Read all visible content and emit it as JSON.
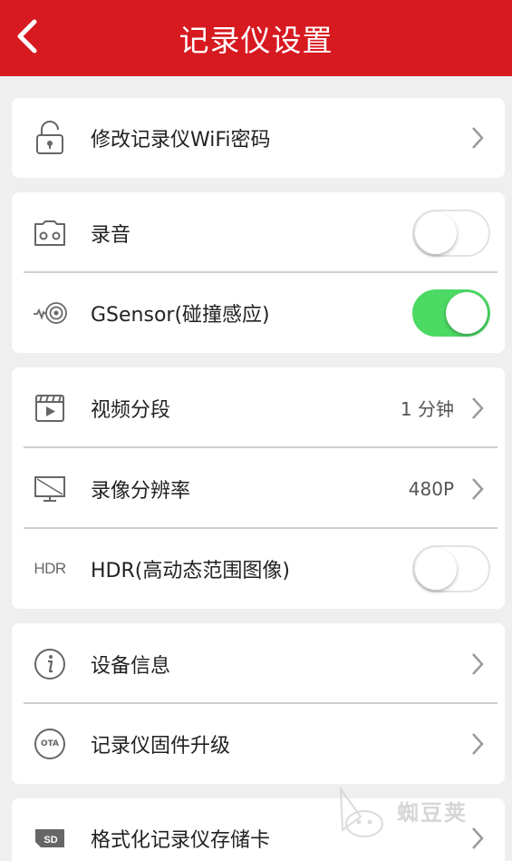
{
  "header": {
    "title": "记录仪设置",
    "back_icon": "chevron-left-icon",
    "background_color": "#d71920"
  },
  "groups": [
    {
      "rows": [
        {
          "label": "修改记录仪WiFi密码",
          "icon": "lock-icon",
          "control": "chevron"
        }
      ]
    },
    {
      "rows": [
        {
          "label": "录音",
          "icon": "cassette-icon",
          "control": "toggle",
          "toggle_on": false
        },
        {
          "label": "GSensor(碰撞感应)",
          "icon": "gsensor-icon",
          "control": "toggle",
          "toggle_on": true
        }
      ]
    },
    {
      "rows": [
        {
          "label": "视频分段",
          "icon": "clapperboard-icon",
          "control": "chevron",
          "value": "1 分钟"
        },
        {
          "label": "录像分辨率",
          "icon": "monitor-icon",
          "control": "chevron",
          "value": "480P"
        },
        {
          "label": "HDR(高动态范围图像)",
          "icon": "hdr-icon",
          "icon_text": "HDR",
          "control": "toggle",
          "toggle_on": false
        }
      ]
    },
    {
      "rows": [
        {
          "label": "设备信息",
          "icon": "info-icon",
          "control": "chevron"
        },
        {
          "label": "记录仪固件升级",
          "icon": "ota-icon",
          "icon_text": "OTA",
          "control": "chevron"
        }
      ]
    },
    {
      "rows": [
        {
          "label": "格式化记录仪存储卡",
          "icon": "sd-card-icon",
          "icon_text": "SD",
          "control": "chevron"
        }
      ]
    }
  ],
  "watermark": {
    "text": "蜘豆荚"
  },
  "colors": {
    "toggle_on": "#4cd964",
    "chevron": "#9a9a9a",
    "icon": "#666666"
  }
}
